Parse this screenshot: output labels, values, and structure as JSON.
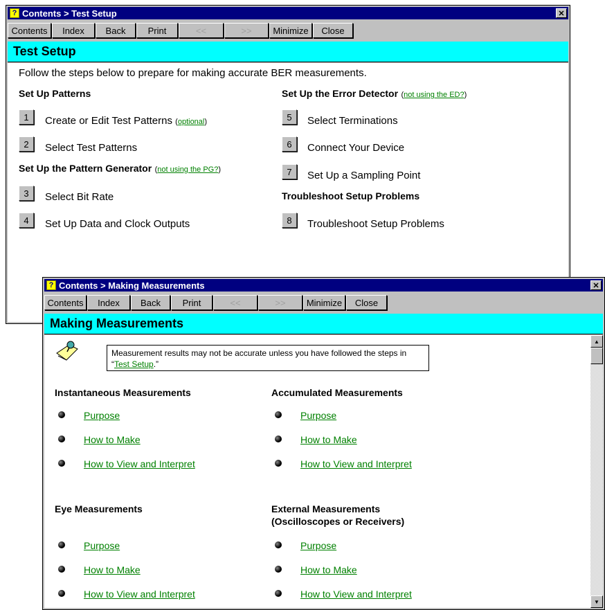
{
  "win1": {
    "title": "Contents > Test Setup",
    "close_glyph": "✕",
    "toolbar": [
      "Contents",
      "Index",
      "Back",
      "Print",
      "<<",
      ">>",
      "Minimize",
      "Close"
    ],
    "heading": "Test Setup",
    "intro": "Follow the steps below to prepare for making accurate BER measurements.",
    "sec_patterns": "Set Up Patterns",
    "sec_pg": "Set Up the Pattern Generator",
    "sec_pg_note_prefix": "(",
    "sec_pg_note_link": "not using the PG?",
    "sec_pg_note_suffix": ")",
    "sec_ed": "Set Up the Error Detector",
    "sec_ed_note_prefix": "(",
    "sec_ed_note_link": "not using the ED?",
    "sec_ed_note_suffix": ")",
    "sec_trouble": "Troubleshoot Setup Problems",
    "steps": [
      {
        "num": "1",
        "label": "Create or Edit Test Patterns",
        "extra_prefix": "(",
        "extra_link": "optional",
        "extra_suffix": ")"
      },
      {
        "num": "2",
        "label": "Select Test Patterns"
      },
      {
        "num": "3",
        "label": "Select Bit Rate"
      },
      {
        "num": "4",
        "label": "Set Up Data and Clock Outputs"
      },
      {
        "num": "5",
        "label": "Select Terminations"
      },
      {
        "num": "6",
        "label": "Connect Your Device"
      },
      {
        "num": "7",
        "label": "Set Up a Sampling Point"
      },
      {
        "num": "8",
        "label": "Troubleshoot Setup Problems"
      }
    ]
  },
  "win2": {
    "title": "Contents > Making Measurements",
    "close_glyph": "✕",
    "toolbar": [
      "Contents",
      "Index",
      "Back",
      "Print",
      "<<",
      ">>",
      "Minimize",
      "Close"
    ],
    "heading": "Making Measurements",
    "note_prefix": "Measurement results may not be accurate unless you have followed the steps in “",
    "note_link": "Test Setup",
    "note_suffix": ".”",
    "sections": {
      "instant": "Instantaneous Measurements",
      "accum": "Accumulated Measurements",
      "eye": "Eye Measurements",
      "external_1": "External Measurements",
      "external_2": "(Oscilloscopes or Receivers)"
    },
    "links": {
      "purpose": "Purpose",
      "how_make": "How to Make",
      "how_view": "How to View and Interpret"
    },
    "scroll_up": "▲",
    "scroll_down": "▼",
    "icons": {
      "note": "pushpin-note-icon",
      "bullet": "bullet-icon"
    }
  }
}
